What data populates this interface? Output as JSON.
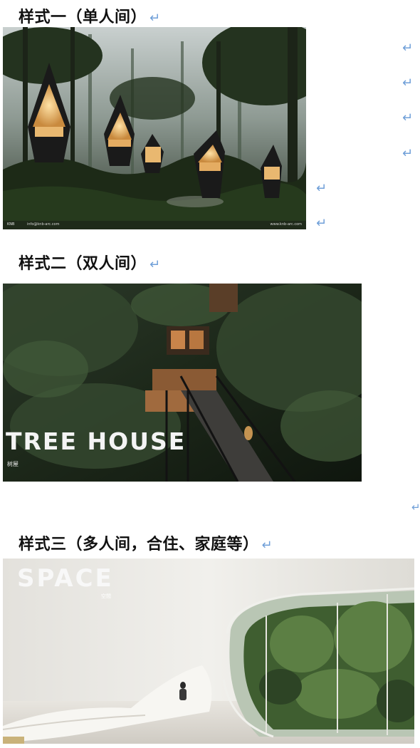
{
  "return_mark": "↵",
  "sections": [
    {
      "heading": "样式一（单人间）"
    },
    {
      "heading": "样式二（双人间）"
    },
    {
      "heading": "样式三（多人间，合住、家庭等）"
    }
  ],
  "images": {
    "img1": {
      "subject": "treehouse-pods-forest",
      "logo_text": "KNB",
      "caption_left": "info@knb-arc.com",
      "caption_right": "www.knb-arc.com"
    },
    "img2": {
      "subject": "treehouse-walkway-forest",
      "title": "TREE HOUSE",
      "subtitle": "树屋"
    },
    "img3": {
      "subject": "interior-space-courtyard",
      "title": "SPACE",
      "subtitle": "空間"
    }
  },
  "colors": {
    "return_mark": "#6f9fd8",
    "heading": "#111111"
  }
}
